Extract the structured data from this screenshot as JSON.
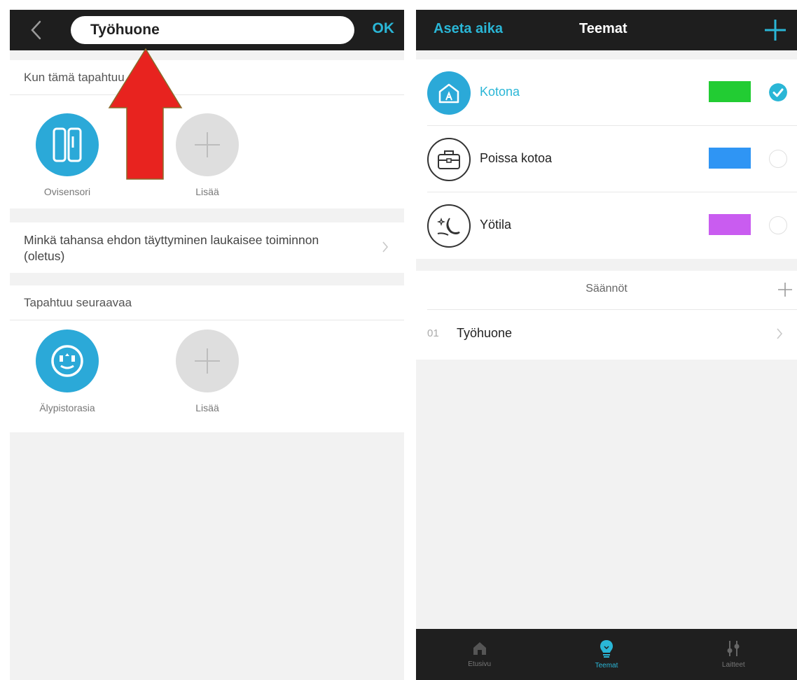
{
  "left": {
    "back_icon": "chevron-left-icon",
    "scene_name": "Työhuone",
    "ok_label": "OK",
    "when_label": "Kun tämä tapahtuu",
    "trigger_devices": [
      {
        "label": "Ovisensori",
        "icon": "door-sensor-icon"
      },
      {
        "label": "Lisää",
        "icon": "plus-icon"
      }
    ],
    "condition_text": "Minkä tahansa ehdon täyttyminen laukaisee toiminnon (oletus)",
    "then_label": "Tapahtuu seuraavaa",
    "action_devices": [
      {
        "label": "Älypistorasia",
        "icon": "smart-plug-icon"
      },
      {
        "label": "Lisää",
        "icon": "plus-icon"
      }
    ],
    "annotation_color": "#e8231f"
  },
  "right": {
    "set_time_label": "Aseta aika",
    "title": "Teemat",
    "add_icon": "plus-icon",
    "themes": [
      {
        "name": "Kotona",
        "icon": "home-icon",
        "color": "#22cc33",
        "selected": true
      },
      {
        "name": "Poissa kotoa",
        "icon": "briefcase-icon",
        "color": "#2f95f4",
        "selected": false
      },
      {
        "name": "Yötila",
        "icon": "moon-icon",
        "color": "#c95cf0",
        "selected": false
      }
    ],
    "rules_title": "Säännöt",
    "rules": [
      {
        "number": "01",
        "name": "Työhuone"
      }
    ],
    "tabs": [
      {
        "label": "Etusivu",
        "icon": "home-icon",
        "active": false
      },
      {
        "label": "Teemat",
        "icon": "lightbulb-icon",
        "active": true
      },
      {
        "label": "Laitteet",
        "icon": "devices-icon",
        "active": false
      }
    ],
    "accent_color": "#2ab6d6"
  }
}
